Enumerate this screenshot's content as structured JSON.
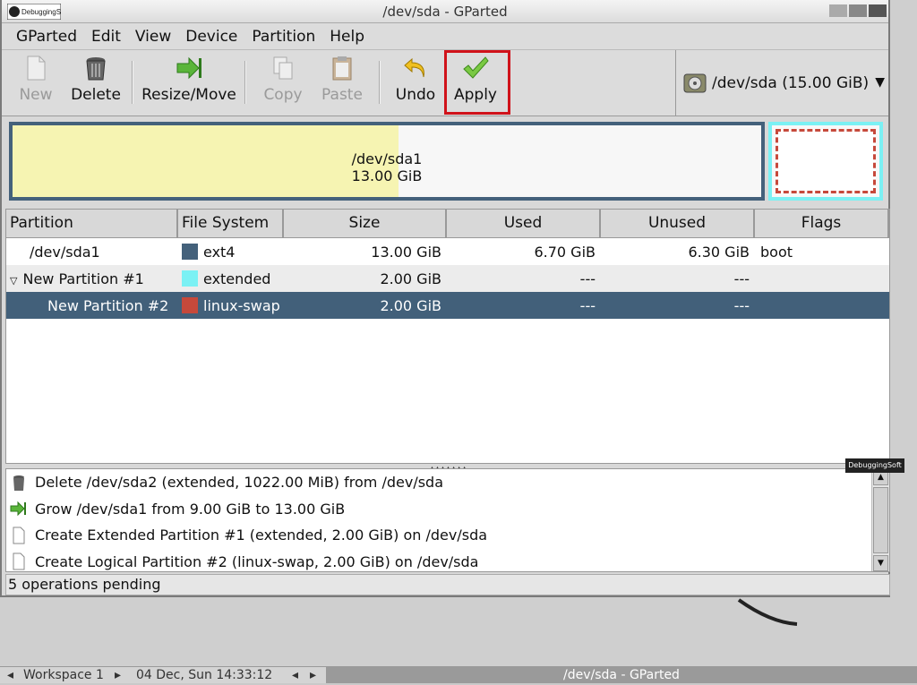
{
  "window": {
    "title": "/dev/sda - GParted",
    "logo_text": "DebuggingSoft"
  },
  "menu": [
    "GParted",
    "Edit",
    "View",
    "Device",
    "Partition",
    "Help"
  ],
  "toolbar": {
    "new": "New",
    "delete": "Delete",
    "resize_move": "Resize/Move",
    "copy": "Copy",
    "paste": "Paste",
    "undo": "Undo",
    "apply": "Apply"
  },
  "device": {
    "label": "/dev/sda  (15.00 GiB)"
  },
  "graph": {
    "sda1_name": "/dev/sda1",
    "sda1_size": "13.00 GiB",
    "sda1_used_fraction": 0.515
  },
  "table": {
    "headers": [
      "Partition",
      "File System",
      "Size",
      "Used",
      "Unused",
      "Flags"
    ],
    "rows": [
      {
        "partition": "/dev/sda1",
        "fs": "ext4",
        "fs_color": "#44617b",
        "size": "13.00 GiB",
        "used": "6.70 GiB",
        "unused": "6.30 GiB",
        "flags": "boot"
      },
      {
        "partition": "New Partition #1",
        "fs": "extended",
        "fs_color": "#7bf1f4",
        "size": "2.00 GiB",
        "used": "---",
        "unused": "---",
        "flags": ""
      },
      {
        "partition": "New Partition #2",
        "fs": "linux-swap",
        "fs_color": "#c6493b",
        "size": "2.00 GiB",
        "used": "---",
        "unused": "---",
        "flags": ""
      }
    ]
  },
  "operations": [
    {
      "icon": "delete-icon",
      "text": "Delete /dev/sda2 (extended, 1022.00 MiB) from /dev/sda"
    },
    {
      "icon": "resize-icon",
      "text": "Grow /dev/sda1 from 9.00 GiB to 13.00 GiB"
    },
    {
      "icon": "new-document-icon",
      "text": "Create Extended Partition #1 (extended, 2.00 GiB) on /dev/sda"
    },
    {
      "icon": "new-document-icon",
      "text": "Create Logical Partition #2 (linux-swap, 2.00 GiB) on /dev/sda"
    }
  ],
  "watermark": "DebuggingSoft",
  "status": "5 operations pending",
  "taskbar": {
    "workspace": "Workspace 1",
    "clock": "04 Dec, Sun 14:33:12",
    "app": "/dev/sda - GParted"
  }
}
